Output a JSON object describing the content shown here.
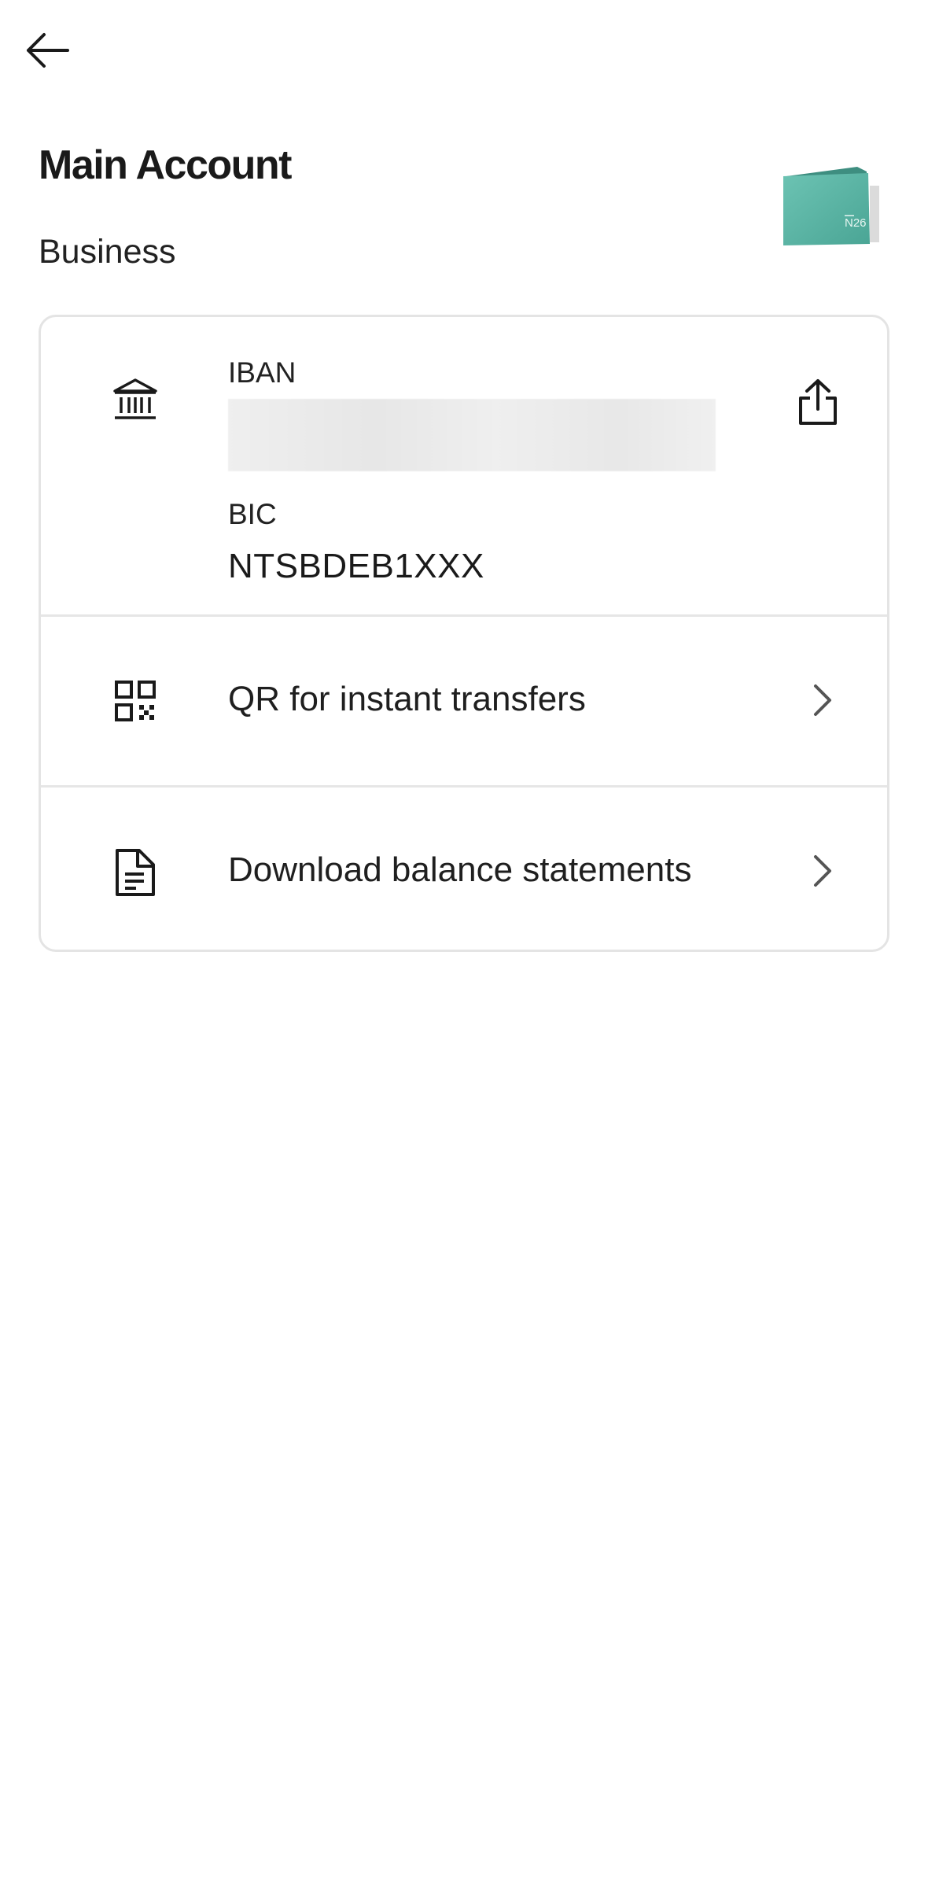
{
  "header": {
    "back_icon": "arrow-left-icon",
    "title": "Main Account",
    "subtitle": "Business",
    "wallet_logo_text": "N26",
    "wallet_color": "#5fb8a8"
  },
  "card": {
    "iban": {
      "icon": "bank-icon",
      "label": "IBAN",
      "value_redacted": true,
      "share_icon": "share-icon"
    },
    "bic": {
      "label": "BIC",
      "value": "NTSBDEB1XXX"
    },
    "items": [
      {
        "icon": "qr-code-icon",
        "label": "QR for instant transfers",
        "chevron": "chevron-right-icon"
      },
      {
        "icon": "document-icon",
        "label": "Download balance statements",
        "chevron": "chevron-right-icon"
      }
    ]
  }
}
